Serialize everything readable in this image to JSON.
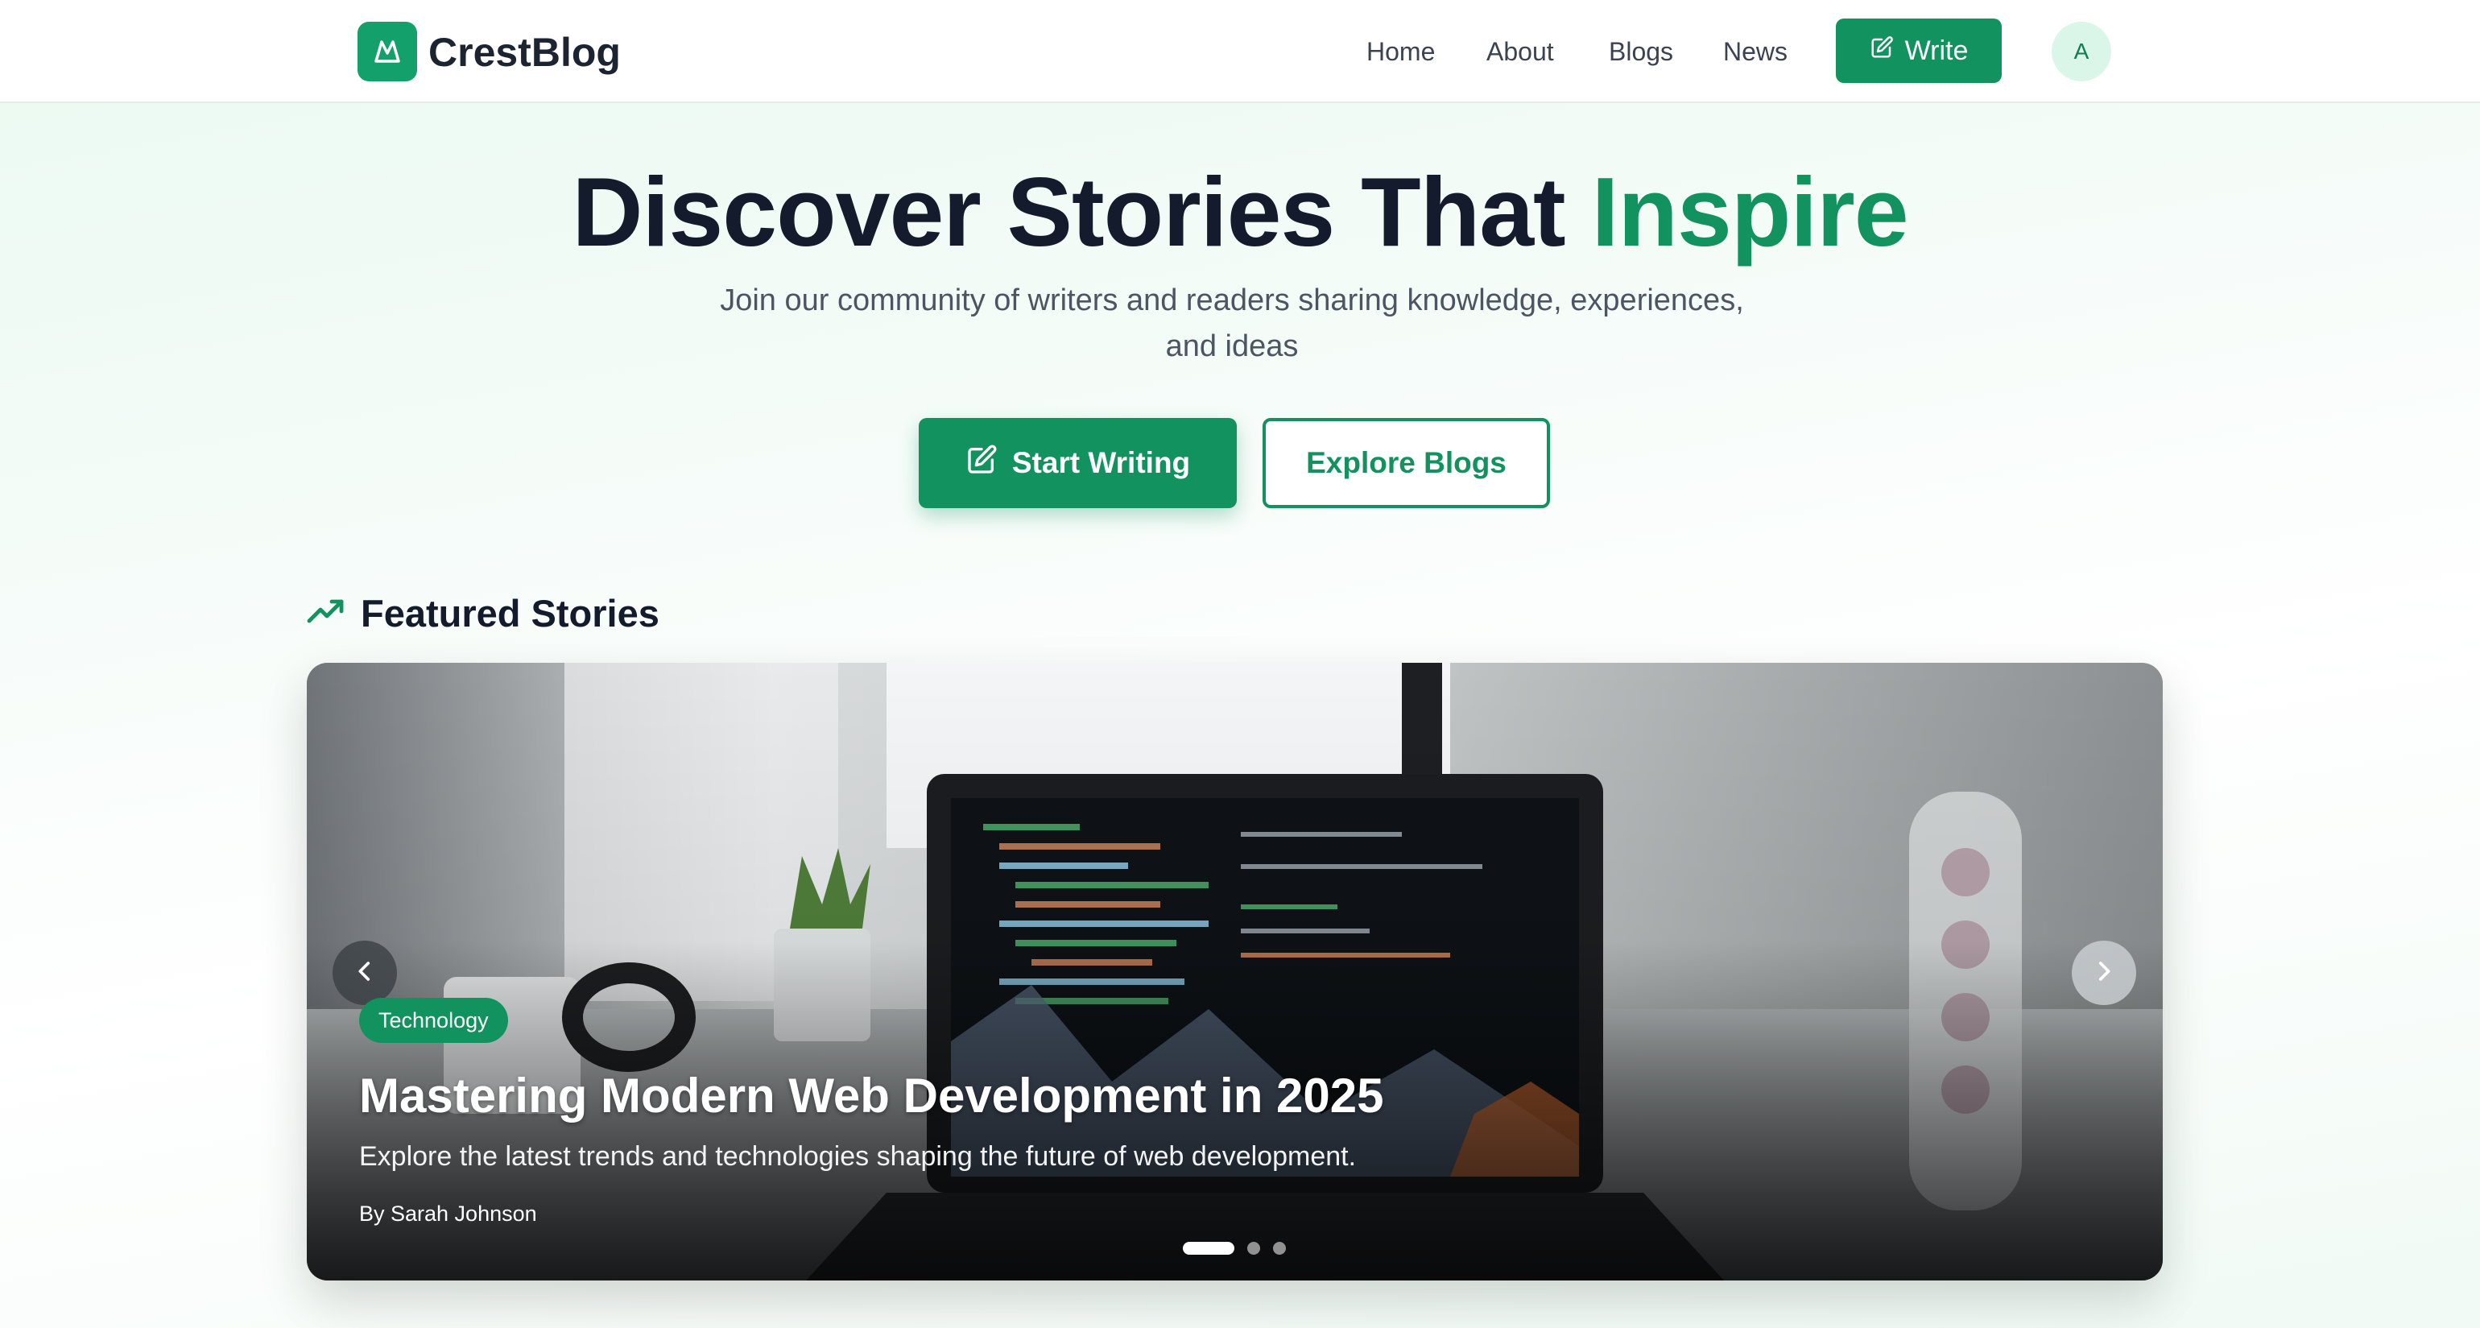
{
  "header": {
    "brand": "CrestBlog",
    "nav": [
      "Home",
      "About",
      "Blogs",
      "News"
    ],
    "write_label": "Write",
    "avatar_initial": "A"
  },
  "hero": {
    "title_main": "Discover Stories That ",
    "title_accent": "Inspire",
    "subtitle": "Join our community of writers and readers sharing knowledge, experiences, and ideas",
    "primary_button": "Start Writing",
    "secondary_button": "Explore Blogs"
  },
  "featured": {
    "heading": "Featured Stories",
    "slide": {
      "category": "Technology",
      "title": "Mastering Modern Web Development in 2025",
      "description": "Explore the latest trends and technologies shaping the future of web development.",
      "author": "By Sarah Johnson"
    },
    "slide_count": 3,
    "active_slide": 1
  },
  "colors": {
    "accent": "#12925f",
    "text_dark": "#141b2d",
    "avatar_bg": "#d9f6e8"
  },
  "icons": [
    "logo-mountain-icon",
    "edit-icon",
    "trending-up-icon",
    "chevron-left-icon",
    "chevron-right-icon"
  ]
}
